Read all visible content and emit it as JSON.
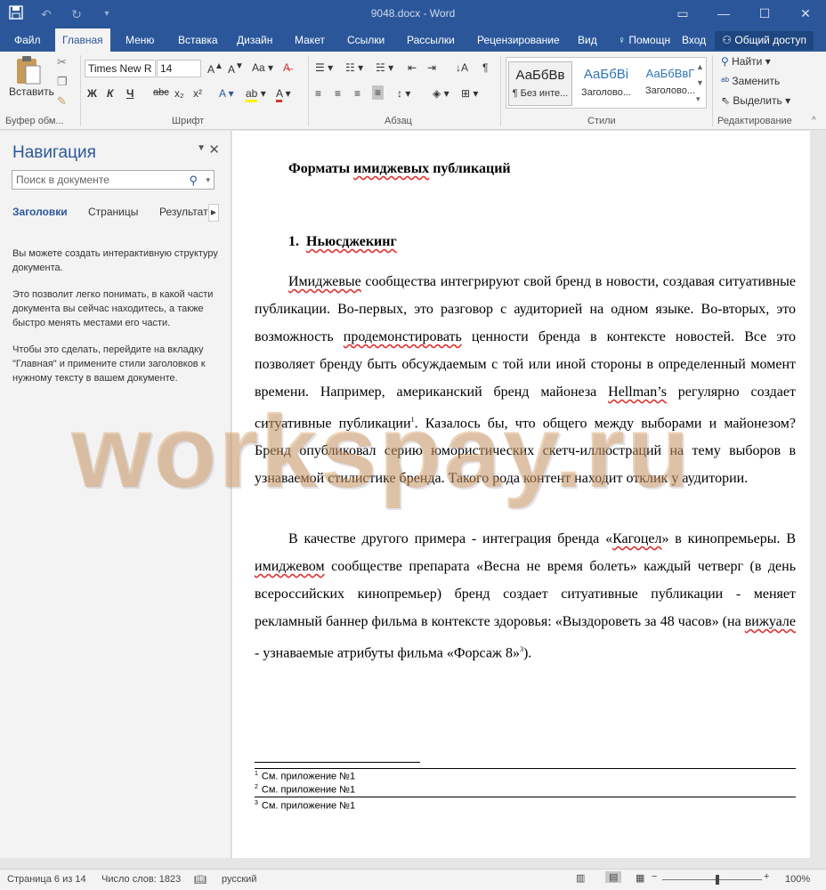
{
  "window": {
    "title": "9048.docx - Word",
    "qat": [
      "save-icon",
      "undo-icon",
      "redo-icon",
      "customize-icon"
    ],
    "controls": [
      "restore-ribbon-icon",
      "minimize-icon",
      "maximize-icon",
      "close-icon"
    ]
  },
  "tabs": {
    "file": "Файл",
    "home": "Главная",
    "menu": "Меню",
    "insert": "Вставка",
    "design": "Дизайн",
    "layout": "Макет",
    "references": "Ссылки",
    "mailings": "Рассылки",
    "review": "Рецензирование",
    "view": "Вид",
    "help": "Помощн",
    "signin": "Вход",
    "share": "Общий доступ"
  },
  "ribbon": {
    "paste": "Вставить",
    "clipboard_label": "Буфер обм...",
    "font_name": "Times New R",
    "font_size": "14",
    "font_label": "Шрифт",
    "paragraph_label": "Абзац",
    "styles_label": "Стили",
    "editing_label": "Редактирование",
    "bold": "Ж",
    "italic": "К",
    "underline": "Ч",
    "strike": "abc",
    "subscript": "x₂",
    "superscript": "x²",
    "styles": [
      {
        "sample": "АаБбВв",
        "caption": "¶ Без инте..."
      },
      {
        "sample": "АаБбВі",
        "caption": "Заголово..."
      },
      {
        "sample": "АаБбВвГ",
        "caption": "Заголово..."
      }
    ],
    "find": "Найти",
    "replace": "Заменить",
    "select": "Выделить"
  },
  "nav": {
    "title": "Навигация",
    "search_placeholder": "Поиск в документе",
    "tab_headings": "Заголовки",
    "tab_pages": "Страницы",
    "tab_results": "Результать",
    "para1": "Вы можете создать интерактивную структуру документа.",
    "para2": "Это позволит легко понимать, в какой части документа вы сейчас находитесь, а также быстро менять местами его части.",
    "para3": "Чтобы это сделать, перейдите на вкладку \"Главная\" и примените стили заголовков к нужному тексту в вашем документе."
  },
  "doc": {
    "title_pre": "Форматы ",
    "title_sq": "имиджевых",
    "title_post": " публикаций",
    "h1_num": "1.",
    "h1_text": "Ньюсджекинг",
    "p1": [
      {
        "t": "Имиджевые",
        "sq": true
      },
      {
        "t": " сообщества интегрируют свой бренд в новости, создавая ситуативные публикации. Во-первых, это разговор с аудиторией на одном языке. Во-вторых, это возможность "
      },
      {
        "t": "продемонстировать",
        "sq": true
      },
      {
        "t": " ценности бренда в контексте новостей. Все это позволяет бренду быть обсуждаемым с той или иной стороны в определенный момент времени. Например, американский бренд майонеза "
      },
      {
        "t": "Hellman’s",
        "sq": true
      },
      {
        "t": " регулярно создает ситуативные публикации"
      },
      {
        "t": "1",
        "sup": true
      },
      {
        "t": ". Казалось бы, что общего между выборами и майонезом? Бренд опубликовал серию юмористических скетч-иллюстраций на тему выборов в узнаваемой стилистике бренда. Такого рода контент находит отклик у аудитории."
      }
    ],
    "p2": [
      {
        "t": "В качестве другого примера - интеграция бренда «"
      },
      {
        "t": "Кагоцел",
        "sq": true
      },
      {
        "t": "» в кинопремьеры. В "
      },
      {
        "t": "имиджевом",
        "sq": true
      },
      {
        "t": " сообществе препарата «Весна не время болеть» каждый четверг (в день всероссийских кинопремьер) бренд создает ситуативные публикации - меняет рекламный баннер фильма в контексте здоровья: «Выздороветь за 48 часов» (на "
      },
      {
        "t": "вижуале",
        "sq": true
      },
      {
        "t": " - узнаваемые атрибуты фильма «Форсаж 8»"
      },
      {
        "t": "3",
        "sup": true
      },
      {
        "t": ")."
      }
    ],
    "footnotes": [
      {
        "mark": "1",
        "text": "См. приложение №1"
      },
      {
        "mark": "2",
        "text": "См. приложение №1"
      },
      {
        "mark": "3",
        "text": "См. приложение №1"
      }
    ],
    "watermark": "workspay.ru"
  },
  "status": {
    "page": "Страница 6 из 14",
    "words": "Число слов: 1823",
    "lang": "русский",
    "zoom": "100%"
  }
}
